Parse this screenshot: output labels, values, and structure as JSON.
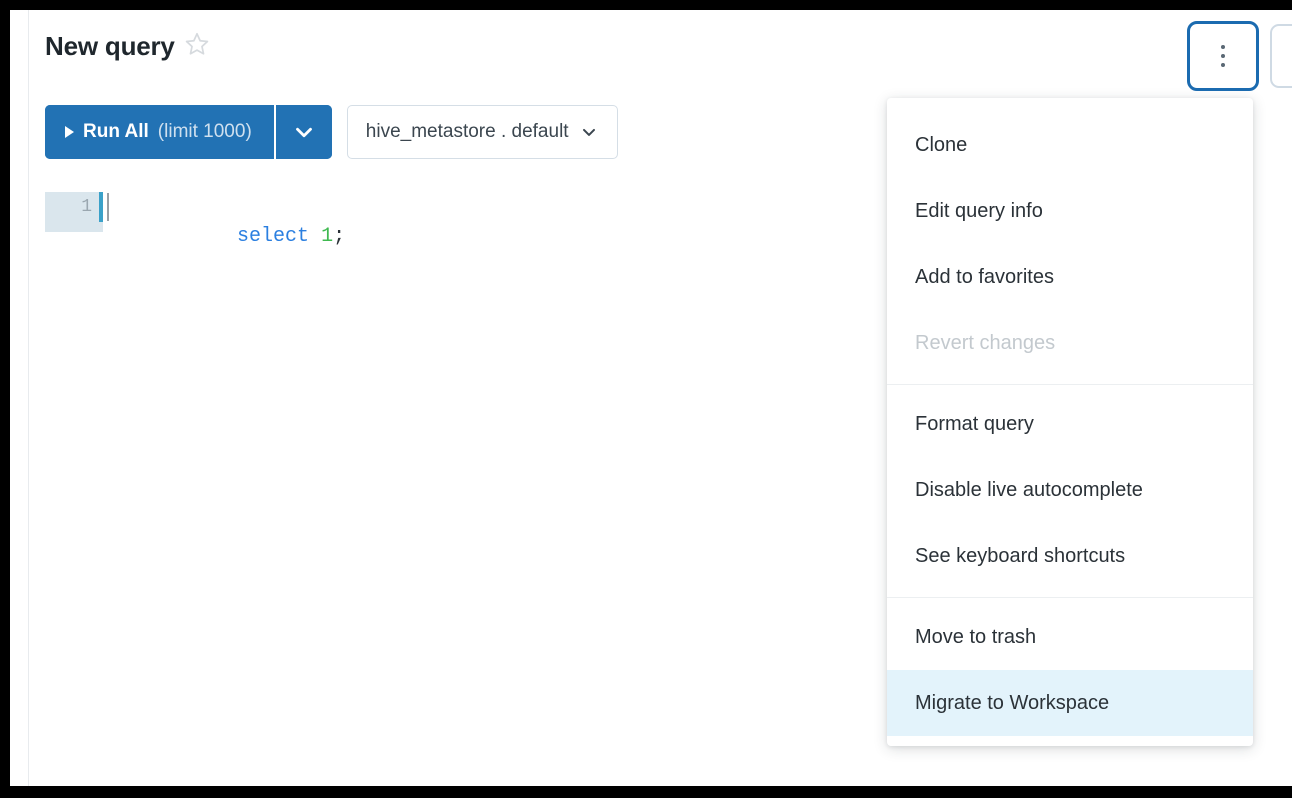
{
  "window": {
    "border_color": "#000000",
    "background": "#ffffff"
  },
  "header": {
    "title": "New query",
    "favorite_icon": "star-outline-icon",
    "favorited": false
  },
  "toolbar": {
    "run_button": {
      "play_icon": "play-triangle-icon",
      "label": "Run All",
      "limit_label": "(limit 1000)",
      "caret_icon": "chevron-down-icon",
      "accent_color": "#2272b4"
    },
    "catalog_selector": {
      "value": "hive_metastore . default",
      "caret_icon": "chevron-down-icon"
    },
    "overflow_button": {
      "icon": "kebab-menu-icon",
      "focused": true,
      "focus_color": "#1b6bb0"
    }
  },
  "editor": {
    "line_number": "1",
    "code": {
      "keyword": "select",
      "space": " ",
      "number": "1",
      "punctuation": ";"
    },
    "active_line_color": "#dae6ed",
    "accent_color": "#3aa1c9"
  },
  "menu": {
    "highlight_color": "#e3f3fb",
    "groups": [
      {
        "items": [
          {
            "label": "Clone",
            "disabled": false,
            "highlighted": false
          },
          {
            "label": "Edit query info",
            "disabled": false,
            "highlighted": false
          },
          {
            "label": "Add to favorites",
            "disabled": false,
            "highlighted": false
          },
          {
            "label": "Revert changes",
            "disabled": true,
            "highlighted": false
          }
        ]
      },
      {
        "items": [
          {
            "label": "Format query",
            "disabled": false,
            "highlighted": false
          },
          {
            "label": "Disable live autocomplete",
            "disabled": false,
            "highlighted": false
          },
          {
            "label": "See keyboard shortcuts",
            "disabled": false,
            "highlighted": false
          }
        ]
      },
      {
        "items": [
          {
            "label": "Move to trash",
            "disabled": false,
            "highlighted": false
          },
          {
            "label": "Migrate to Workspace",
            "disabled": false,
            "highlighted": true
          }
        ]
      }
    ]
  }
}
